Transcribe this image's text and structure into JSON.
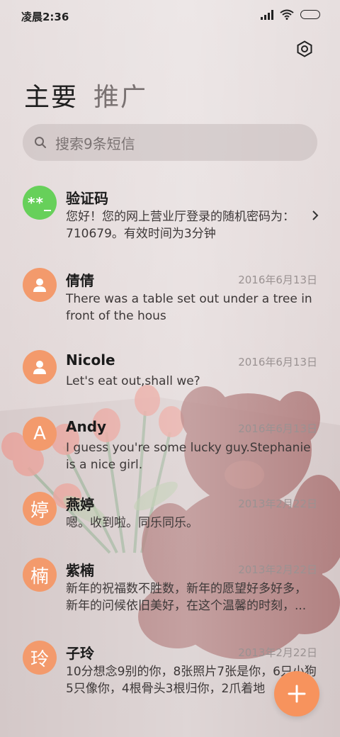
{
  "status": {
    "time": "凌晨2:36",
    "icons": [
      "signal-icon",
      "wifi-icon",
      "battery-icon"
    ]
  },
  "header": {
    "settings_icon": "settings-icon",
    "tabs": [
      {
        "label": "主要",
        "active": true
      },
      {
        "label": "推广",
        "active": false
      }
    ]
  },
  "search": {
    "placeholder": "搜索9条短信",
    "icon": "search-icon"
  },
  "messages": [
    {
      "avatar": "**_",
      "avatar_color": "#67d05a",
      "name": "验证码",
      "date": "",
      "preview": "您好！您的网上营业厅登录的随机密码为：710679。有效时间为3分钟",
      "has_chevron": true
    },
    {
      "avatar": "person",
      "avatar_color": "#f39a6c",
      "name": "倩倩",
      "date": "2016年6月13日",
      "preview": "There was a table set out under a tree in front of the hous"
    },
    {
      "avatar": "person",
      "avatar_color": "#f39a6c",
      "name": "Nicole",
      "date": "2016年6月13日",
      "preview": "Let's eat out,shall we?"
    },
    {
      "avatar": "A",
      "avatar_color": "#f39a6c",
      "name": "Andy",
      "date": "2016年6月13日",
      "preview": "I guess you're some lucky guy.Stephanie is a nice girl."
    },
    {
      "avatar": "婷",
      "avatar_color": "#f39a6c",
      "name": "燕婷",
      "date": "2013年2月22日",
      "preview": "嗯。收到啦。同乐同乐。"
    },
    {
      "avatar": "楠",
      "avatar_color": "#f39a6c",
      "name": "紫楠",
      "date": "2013年2月22日",
      "preview": "新年的祝福数不胜数，新年的愿望好多好多，新年的问候依旧美好，在这个温馨的时刻，..."
    },
    {
      "avatar": "玲",
      "avatar_color": "#f39a6c",
      "name": "子玲",
      "date": "2013年2月22日",
      "preview": "10分想念9别的你，8张照片7张是你，6只小狗5只像你，4根骨头3根归你，2爪着地"
    }
  ],
  "fab": {
    "label": "+",
    "icon": "plus-icon"
  }
}
